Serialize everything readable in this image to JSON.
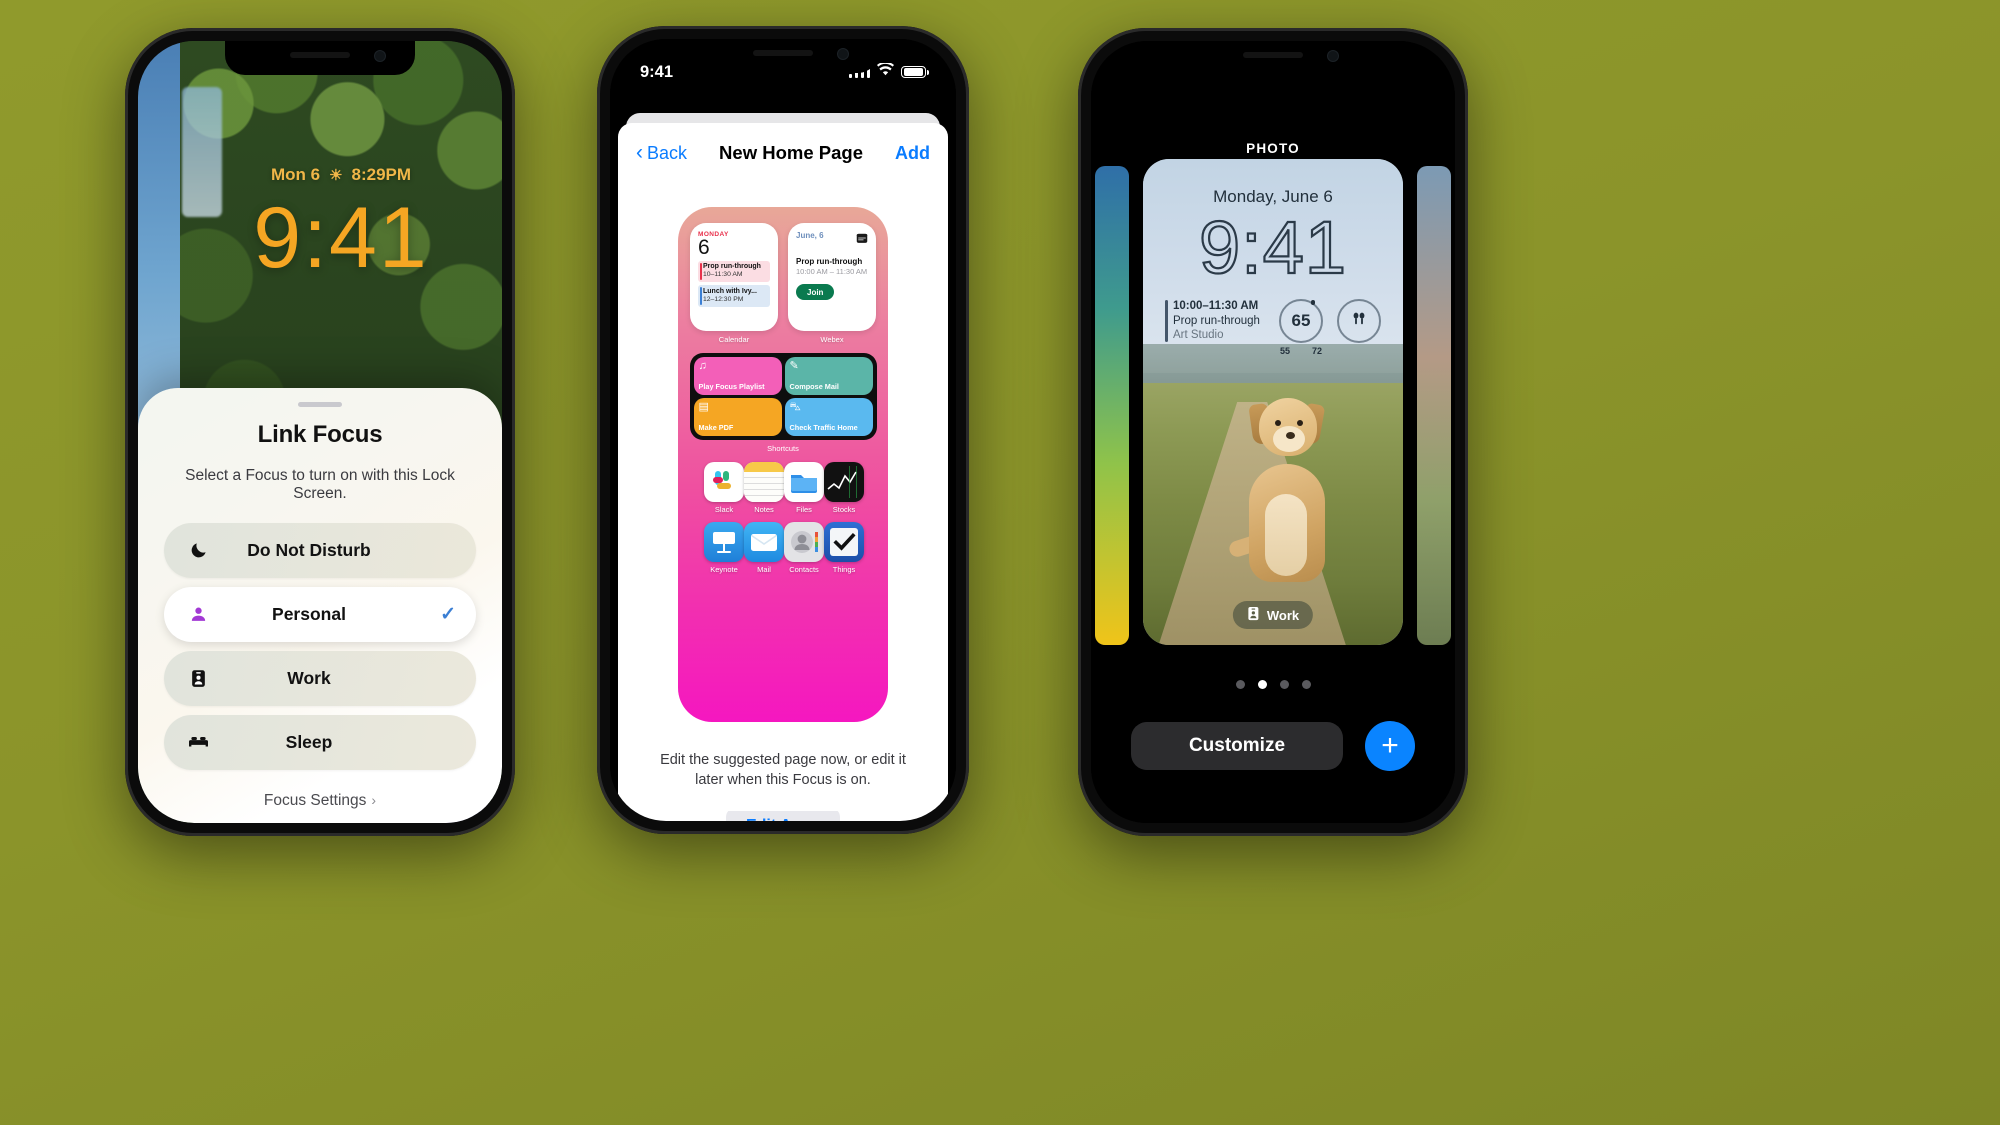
{
  "scene": {
    "background_color": "#8a9329"
  },
  "phone_left": {
    "lock_screen": {
      "date_line": "Mon 6",
      "weather_icon": "sunset-icon",
      "sunset_time": "8:29PM",
      "clock": "9:41"
    },
    "sheet": {
      "title": "Link Focus",
      "subtitle": "Select a Focus to turn on with this Lock Screen.",
      "options": [
        {
          "icon": "moon-icon",
          "glyph": "☾",
          "label": "Do Not Disturb",
          "selected": false
        },
        {
          "icon": "person-icon",
          "glyph": "●",
          "label": "Personal",
          "selected": true
        },
        {
          "icon": "briefcase-badge-icon",
          "glyph": "■",
          "label": "Work",
          "selected": false
        },
        {
          "icon": "bed-icon",
          "glyph": "▬",
          "label": "Sleep",
          "selected": false
        }
      ],
      "checkmark_glyph": "✓",
      "checkmark_color": "#3b7fd4",
      "footer_link": "Focus Settings",
      "footer_chevron": "›"
    }
  },
  "phone_middle": {
    "status_bar": {
      "time": "9:41",
      "cellular_icon": "signal-bars-icon",
      "wifi_icon": "wifi-icon",
      "battery_icon": "battery-icon"
    },
    "nav": {
      "back_label": "Back",
      "back_chevron": "‹",
      "title": "New Home Page",
      "add_label": "Add"
    },
    "home_page_preview": {
      "widgets": [
        {
          "app": "Calendar",
          "weekday": "MONDAY",
          "day_number": "6",
          "events": [
            {
              "title": "Prop run-through",
              "time": "10–11:30 AM",
              "color": "pink"
            },
            {
              "title": "Lunch with Ivy...",
              "time": "12–12:30 PM",
              "color": "blue"
            }
          ]
        },
        {
          "app": "Webex",
          "date": "June, 6",
          "event_title": "Prop run-through",
          "event_time": "10:00 AM – 11:30 AM",
          "button": "Join"
        }
      ],
      "shortcuts": {
        "caption": "Shortcuts",
        "items": [
          {
            "name": "Play Focus Playlist",
            "icon": "music-note-icon",
            "glyph": "♫",
            "color": "#f35fb8"
          },
          {
            "name": "Compose Mail",
            "icon": "compose-icon",
            "glyph": "✎",
            "color": "#5bb5a8"
          },
          {
            "name": "Make PDF",
            "icon": "document-icon",
            "glyph": "▤",
            "color": "#f5a623"
          },
          {
            "name": "Check Traffic Home",
            "icon": "car-icon",
            "glyph": "⛍",
            "color": "#5ab9ef"
          }
        ]
      },
      "apps": [
        {
          "name": "Slack",
          "icon": "slack-icon"
        },
        {
          "name": "Notes",
          "icon": "notes-icon"
        },
        {
          "name": "Files",
          "icon": "files-icon"
        },
        {
          "name": "Stocks",
          "icon": "stocks-icon"
        },
        {
          "name": "Keynote",
          "icon": "keynote-icon"
        },
        {
          "name": "Mail",
          "icon": "mail-icon"
        },
        {
          "name": "Contacts",
          "icon": "contacts-icon"
        },
        {
          "name": "Things",
          "icon": "things-icon"
        }
      ]
    },
    "footer": {
      "description": "Edit the suggested page now, or edit it later when this Focus is on.",
      "button": "Edit Apps"
    }
  },
  "phone_right": {
    "section_label": "PHOTO",
    "lock_screen": {
      "date": "Monday, June 6",
      "clock": "9:41",
      "widgets": {
        "calendar": {
          "time": "10:00–11:30 AM",
          "title": "Prop run-through",
          "location": "Art Studio"
        },
        "temperature": {
          "current": "65",
          "low": "55",
          "high": "72"
        },
        "airpods": {
          "icon": "airpods-icon",
          "glyph": "⚇"
        }
      },
      "focus_badge": {
        "icon": "briefcase-badge-icon",
        "label": "Work"
      }
    },
    "page_dots": {
      "count": 4,
      "active_index": 1
    },
    "actions": {
      "customize_label": "Customize",
      "add_icon": "plus-icon",
      "add_glyph": "+",
      "add_color": "#0a84ff"
    }
  }
}
